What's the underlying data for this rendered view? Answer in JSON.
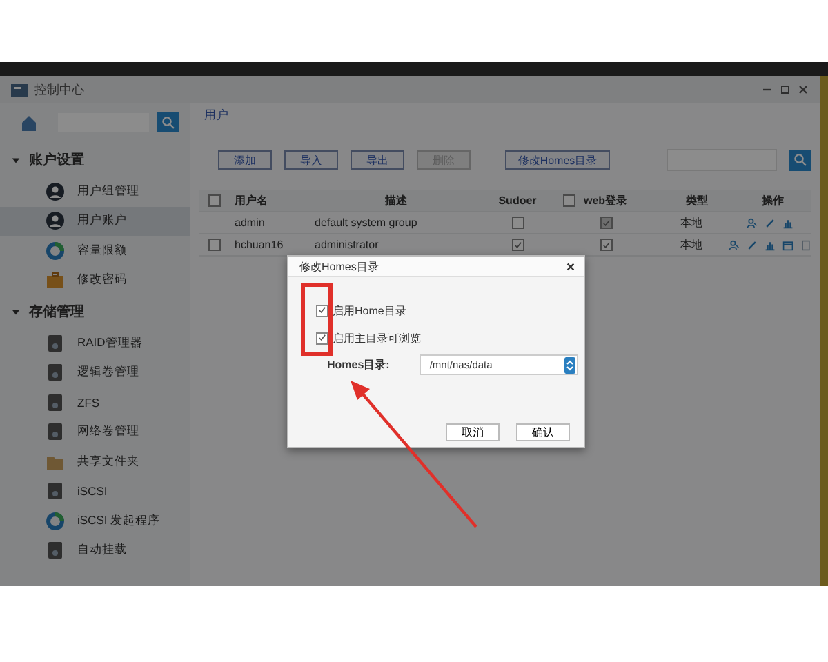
{
  "window": {
    "title": "控制中心"
  },
  "sidebar": {
    "groups": [
      {
        "label": "账户设置",
        "expanded": true,
        "items": [
          {
            "label": "用户组管理",
            "selected": false,
            "kind": "user"
          },
          {
            "label": "用户账户",
            "selected": true,
            "kind": "user"
          },
          {
            "label": "容量限额",
            "selected": false,
            "kind": "ring"
          },
          {
            "label": "修改密码",
            "selected": false,
            "kind": "bag"
          }
        ]
      },
      {
        "label": "存储管理",
        "expanded": true,
        "items": [
          {
            "label": "RAID管理器",
            "selected": false,
            "kind": "disk"
          },
          {
            "label": "逻辑卷管理",
            "selected": false,
            "kind": "disk"
          },
          {
            "label": "ZFS",
            "selected": false,
            "kind": "disk"
          },
          {
            "label": "网络卷管理",
            "selected": false,
            "kind": "disk"
          },
          {
            "label": "共享文件夹",
            "selected": false,
            "kind": "folder"
          },
          {
            "label": "iSCSI",
            "selected": false,
            "kind": "disk"
          },
          {
            "label": "iSCSI 发起程序",
            "selected": false,
            "kind": "ring"
          },
          {
            "label": "自动挂载",
            "selected": false,
            "kind": "disk"
          }
        ]
      }
    ]
  },
  "breadcrumb": "用户",
  "toolbar": [
    {
      "label": "添加",
      "disabled": false
    },
    {
      "label": "导入",
      "disabled": false
    },
    {
      "label": "导出",
      "disabled": false
    },
    {
      "label": "删除",
      "disabled": true
    },
    {
      "label": "修改Homes目录",
      "disabled": false
    }
  ],
  "table": {
    "select_all_checked": false,
    "web_login_all_checked": false,
    "columns": [
      "用户名",
      "描述",
      "Sudoer",
      "web登录",
      "类型",
      "操作"
    ],
    "rows": [
      {
        "name": "admin",
        "description": "default system group",
        "sudoer": false,
        "web_login": true,
        "web_login_disabled": true,
        "type": "本地",
        "actions": [
          {
            "kind": "user"
          },
          {
            "kind": "edit"
          },
          {
            "kind": "chart"
          }
        ]
      },
      {
        "name": "hchuan16",
        "description": "administrator",
        "sudoer": true,
        "web_login": true,
        "web_login_disabled": false,
        "checked": false,
        "type": "本地",
        "actions": [
          {
            "kind": "user"
          },
          {
            "kind": "edit"
          },
          {
            "kind": "chart"
          },
          {
            "kind": "calendar"
          },
          {
            "kind": "file"
          }
        ]
      }
    ]
  },
  "dialog": {
    "title": "修改Homes目录",
    "options": [
      {
        "label": "启用Home目录",
        "checked": true
      },
      {
        "label": "启用主目录可浏览",
        "checked": true
      }
    ],
    "field_label": "Homes目录:",
    "field_value": "/mnt/nas/data",
    "buttons": [
      "取消",
      "确认"
    ]
  }
}
